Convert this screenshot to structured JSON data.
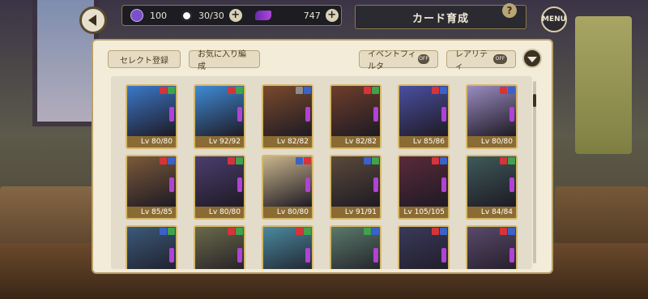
{
  "header": {
    "title": "カード育成",
    "help_label": "?",
    "menu_label": "MENU",
    "coins": "100",
    "stamina": "30/30",
    "gems": "747"
  },
  "toolbar": {
    "select_label": "セレクト登録",
    "favorite_label": "お気に入り編成",
    "event_filter_label": "イベントフィルタ",
    "rarity_label": "レアリティ",
    "toggle_off": "OFF"
  },
  "cards": [
    {
      "level": "Lv 80/80",
      "badges": [
        "r",
        "g"
      ],
      "color": "#3b78c9"
    },
    {
      "level": "Lv 92/92",
      "badges": [
        "r",
        "g"
      ],
      "color": "#3f8bd6"
    },
    {
      "level": "Lv 82/82",
      "badges": [
        "gr",
        "bl"
      ],
      "color": "#7a4a2c"
    },
    {
      "level": "Lv 82/82",
      "badges": [
        "r",
        "g"
      ],
      "color": "#6e3e2a"
    },
    {
      "level": "Lv 85/86",
      "badges": [
        "r",
        "bl"
      ],
      "color": "#4a4fa0"
    },
    {
      "level": "Lv 80/80",
      "badges": [
        "r",
        "bl"
      ],
      "color": "#9a8cc0"
    },
    {
      "level": "Lv 85/85",
      "badges": [
        "r",
        "bl"
      ],
      "color": "#7b5a3a"
    },
    {
      "level": "Lv 80/80",
      "badges": [
        "r",
        "g"
      ],
      "color": "#4b3e6e"
    },
    {
      "level": "Lv 80/80",
      "badges": [
        "bl",
        "r"
      ],
      "color": "#c9b58c"
    },
    {
      "level": "Lv 91/91",
      "badges": [
        "bl",
        "g"
      ],
      "color": "#5a4a3a"
    },
    {
      "level": "Lv 105/105",
      "badges": [
        "r",
        "bl"
      ],
      "color": "#5a2a3a"
    },
    {
      "level": "Lv 84/84",
      "badges": [
        "r",
        "g"
      ],
      "color": "#3e5a5a"
    },
    {
      "level": "",
      "badges": [
        "bl",
        "g"
      ],
      "color": "#3a5a7a"
    },
    {
      "level": "",
      "badges": [
        "r",
        "g"
      ],
      "color": "#6a6a4a"
    },
    {
      "level": "",
      "badges": [
        "r",
        "g"
      ],
      "color": "#4a8aa0"
    },
    {
      "level": "",
      "badges": [
        "g",
        "bl"
      ],
      "color": "#5a7a6a"
    },
    {
      "level": "",
      "badges": [
        "r",
        "bl"
      ],
      "color": "#3a3a5a"
    },
    {
      "level": "",
      "badges": [
        "r",
        "bl"
      ],
      "color": "#5a4a6a"
    }
  ]
}
